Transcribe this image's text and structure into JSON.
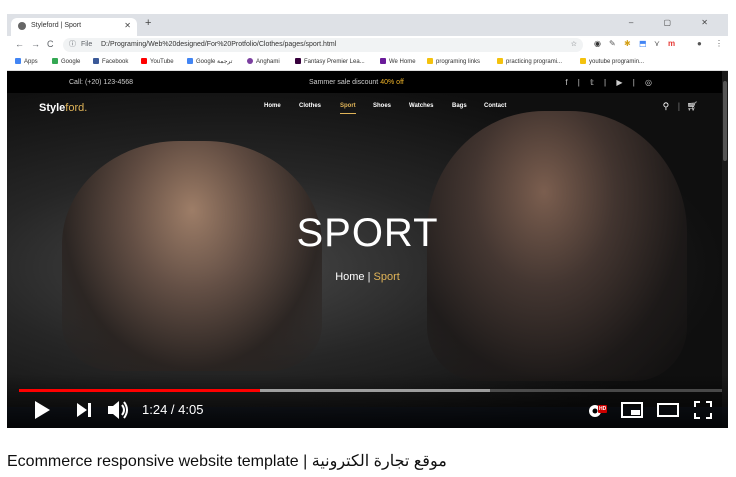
{
  "browser": {
    "tab_title": "Styleford | Sport",
    "tab_close": "✕",
    "new_tab": "+",
    "window_controls": "–  ▢  ✕",
    "nav_back": "←",
    "nav_forward": "→",
    "nav_reload": "C",
    "info_icon": "ⓘ",
    "address_scheme_label": "File",
    "address_url": "D:/Programing/Web%20designed/For%20Protfolio/Clothes/pages/sport.html",
    "bookmark_star": "☆",
    "bookmarks": [
      {
        "label": "Apps",
        "color": "#4285f4"
      },
      {
        "label": "Google",
        "color": "#34a853"
      },
      {
        "label": "Facebook",
        "color": "#3b5998"
      },
      {
        "label": "YouTube",
        "color": "#ff0000"
      },
      {
        "label": "Google ترجمة",
        "color": "#4285f4"
      },
      {
        "label": "Anghami",
        "color": "#7b3fa0"
      },
      {
        "label": "Fantasy Premier Lea...",
        "color": "#37003c"
      },
      {
        "label": "We Home",
        "color": "#6a1b9a"
      },
      {
        "label": "programing links",
        "color": "#f4c20d"
      },
      {
        "label": "practicing programi...",
        "color": "#f4c20d"
      },
      {
        "label": "youtube programin...",
        "color": "#f4c20d"
      }
    ]
  },
  "site": {
    "call_text": "Call: (+20) 123-4568",
    "sale_text": "Sammer sale discount",
    "sale_percent": "40% off",
    "social": "f | 𝕥 | ▶ | ◎",
    "logo_main": "Style",
    "logo_accent": "ford.",
    "menu": [
      "Home",
      "Clothes",
      "Sport",
      "Shoes",
      "Watches",
      "Bags",
      "Contact"
    ],
    "active_menu": "Sport",
    "search_icon": "⚲",
    "cart_icon": "🛒",
    "hero_title": "SPORT",
    "breadcrumb_home": "Home",
    "breadcrumb_sep": "|",
    "breadcrumb_current": "Sport"
  },
  "player": {
    "current_time": "1:24",
    "duration": "4:05",
    "time_display": "1:24 / 4:05",
    "played_fraction": 0.343,
    "buffered_fraction": 0.67,
    "hd_badge": "HD",
    "icons": [
      "play-icon",
      "next-icon",
      "volume-icon",
      "settings-icon",
      "miniplayer-icon",
      "theater-icon",
      "fullscreen-icon"
    ]
  },
  "video_title": "Ecommerce responsive website template | موقع تجارة الكترونية"
}
